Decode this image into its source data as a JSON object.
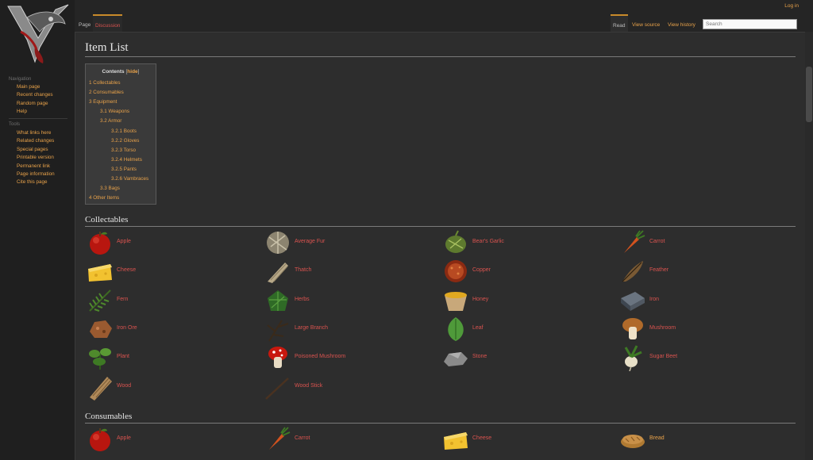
{
  "header": {
    "login": "Log in",
    "tabs_left": [
      "Page",
      "Discussion"
    ],
    "tabs_right": [
      "Read",
      "View source",
      "View history"
    ],
    "search_placeholder": "Search"
  },
  "sidebar": {
    "navigation_heading": "Navigation",
    "navigation": [
      "Main page",
      "Recent changes",
      "Random page",
      "Help"
    ],
    "tools_heading": "Tools",
    "tools": [
      "What links here",
      "Related changes",
      "Special pages",
      "Printable version",
      "Permanent link",
      "Page information",
      "Cite this page"
    ]
  },
  "page": {
    "title": "Item List"
  },
  "toc": {
    "title": "Contents",
    "hide": "hide",
    "items": [
      {
        "num": "1",
        "label": "Collectables",
        "level": 1
      },
      {
        "num": "2",
        "label": "Consumables",
        "level": 1
      },
      {
        "num": "3",
        "label": "Equipment",
        "level": 1
      },
      {
        "num": "3.1",
        "label": "Weapons",
        "level": 2
      },
      {
        "num": "3.2",
        "label": "Armor",
        "level": 2
      },
      {
        "num": "3.2.1",
        "label": "Boots",
        "level": 3
      },
      {
        "num": "3.2.2",
        "label": "Gloves",
        "level": 3
      },
      {
        "num": "3.2.3",
        "label": "Torso",
        "level": 3
      },
      {
        "num": "3.2.4",
        "label": "Helmets",
        "level": 3
      },
      {
        "num": "3.2.5",
        "label": "Pants",
        "level": 3
      },
      {
        "num": "3.2.6",
        "label": "Vambraces",
        "level": 3
      },
      {
        "num": "3.3",
        "label": "Bags",
        "level": 2
      },
      {
        "num": "4",
        "label": "Other Items",
        "level": 1
      }
    ]
  },
  "sections": {
    "collectables": {
      "title": "Collectables",
      "items": [
        {
          "label": "Apple",
          "icon": "apple-icon"
        },
        {
          "label": "Average Fur",
          "icon": "fur-icon"
        },
        {
          "label": "Bear's Garlic",
          "icon": "garlic-icon"
        },
        {
          "label": "Carrot",
          "icon": "carrot-icon"
        },
        {
          "label": "Cheese",
          "icon": "cheese-icon"
        },
        {
          "label": "Thatch",
          "icon": "thatch-icon"
        },
        {
          "label": "Copper",
          "icon": "copper-icon"
        },
        {
          "label": "Feather",
          "icon": "feather-icon"
        },
        {
          "label": "Fern",
          "icon": "fern-icon"
        },
        {
          "label": "Herbs",
          "icon": "herbs-icon"
        },
        {
          "label": "Honey",
          "icon": "honey-icon"
        },
        {
          "label": "Iron",
          "icon": "iron-icon"
        },
        {
          "label": "Iron Ore",
          "icon": "iron-ore-icon"
        },
        {
          "label": "Large Branch",
          "icon": "branch-icon"
        },
        {
          "label": "Leaf",
          "icon": "leaf-icon"
        },
        {
          "label": "Mushroom",
          "icon": "mushroom-icon"
        },
        {
          "label": "Plant",
          "icon": "plant-icon"
        },
        {
          "label": "Poisoned Mushroom",
          "icon": "poisoned-mushroom-icon"
        },
        {
          "label": "Stone",
          "icon": "stone-icon"
        },
        {
          "label": "Sugar Beet",
          "icon": "sugar-beet-icon"
        },
        {
          "label": "Wood",
          "icon": "wood-icon"
        },
        {
          "label": "Wood Stick",
          "icon": "wood-stick-icon"
        }
      ]
    },
    "consumables": {
      "title": "Consumables",
      "items": [
        {
          "label": "Apple",
          "icon": "apple-icon"
        },
        {
          "label": "Carrot",
          "icon": "carrot-icon"
        },
        {
          "label": "Cheese",
          "icon": "cheese-icon"
        },
        {
          "label": "Bread",
          "icon": "bread-icon"
        }
      ]
    }
  },
  "colors": {
    "link": "#e8a24a",
    "redlink": "#d9534f",
    "background": "#2d2d2d"
  }
}
